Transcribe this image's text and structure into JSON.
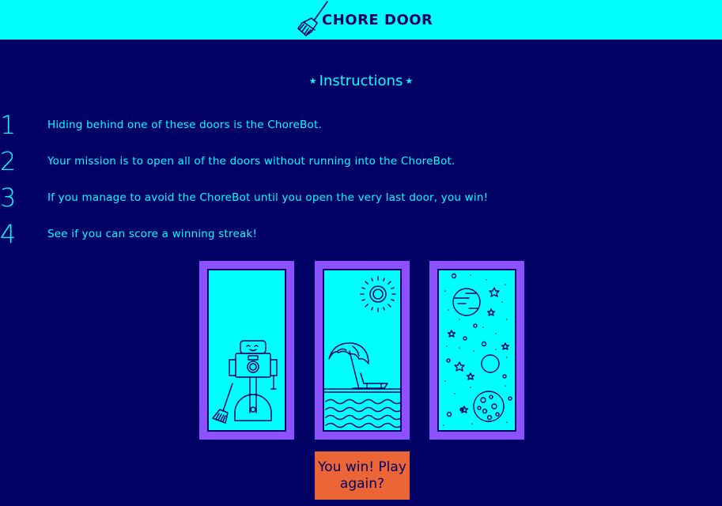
{
  "header": {
    "title": "CHORE DOOR",
    "logo_icon": "broom-icon"
  },
  "instructions": {
    "title": "Instructions",
    "star_icon": "star-icon",
    "steps": [
      {
        "number": "1",
        "text": "Hiding behind one of these doors is the ChoreBot."
      },
      {
        "number": "2",
        "text": "Your mission is to open all of the doors without running into the ChoreBot."
      },
      {
        "number": "3",
        "text": "If you manage to avoid the ChoreBot until you open the very last door, you win!"
      },
      {
        "number": "4",
        "text": "See if you can score a winning streak!"
      }
    ]
  },
  "doors": [
    {
      "content": "chorebot-robot",
      "icon": "robot-icon"
    },
    {
      "content": "beach",
      "icon": "beach-icon"
    },
    {
      "content": "space",
      "icon": "space-icon"
    }
  ],
  "start_button": {
    "label": "You win! Play again?"
  },
  "colors": {
    "background": "#010165",
    "accent": "#00ffff",
    "door_frame": "#8c52ff",
    "button": "#eb6536"
  }
}
